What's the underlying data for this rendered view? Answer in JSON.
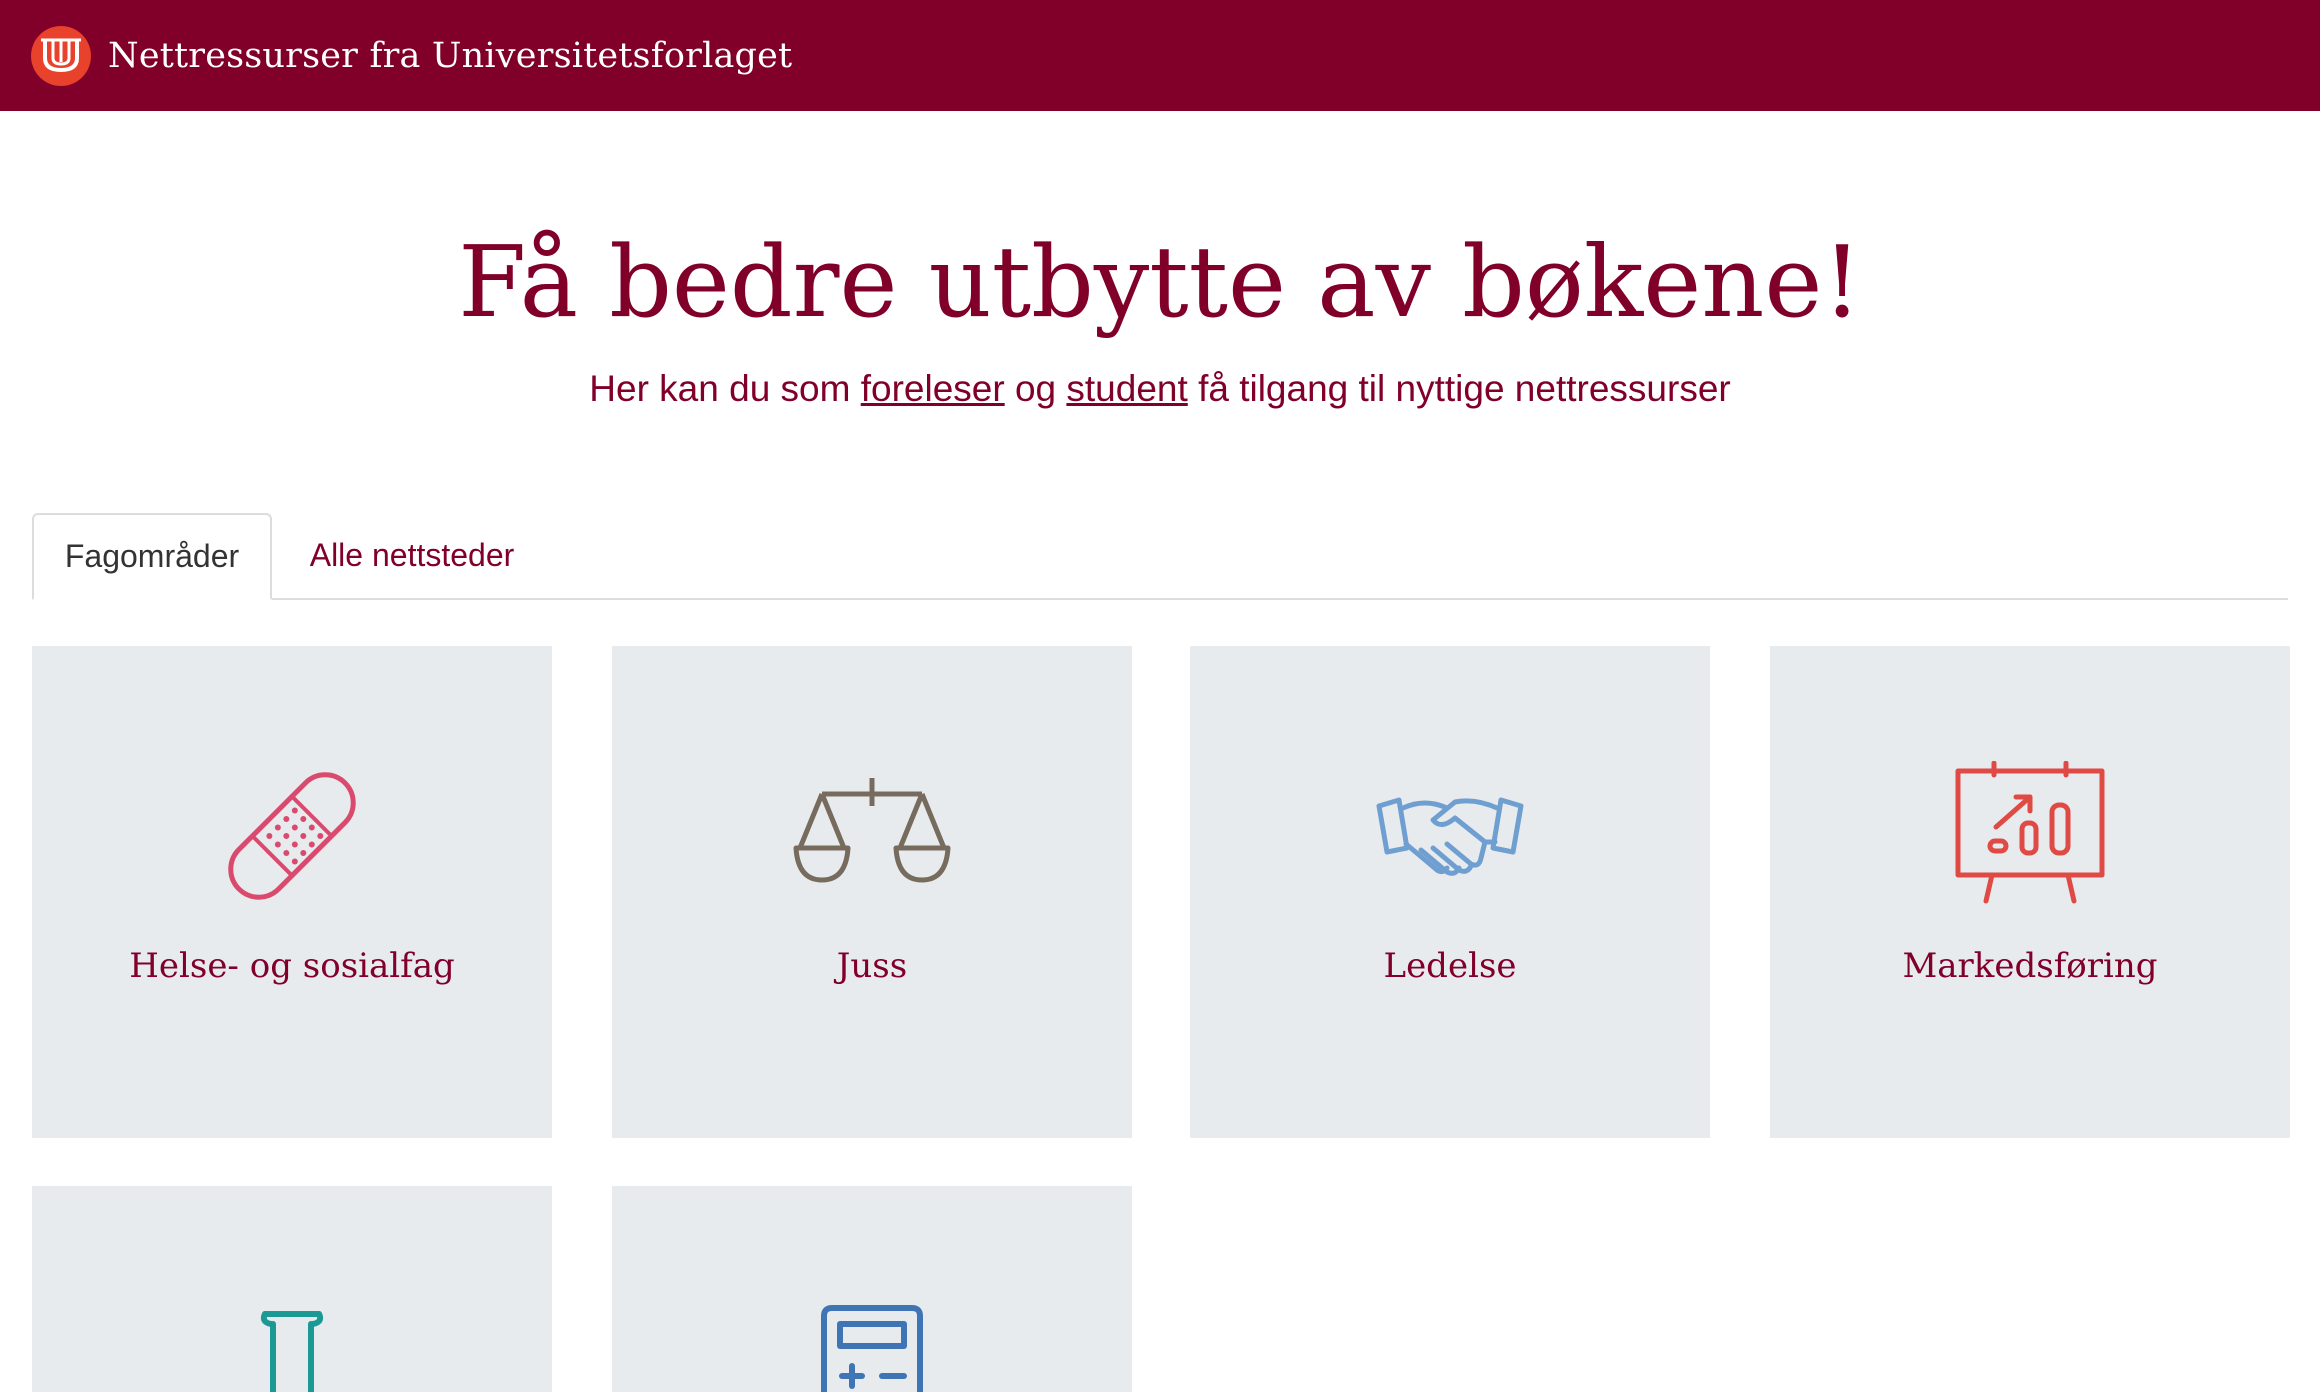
{
  "header": {
    "title": "Nettressurser fra Universitetsforlaget",
    "brand_color": "#80002a",
    "logo_color": "#e8412c"
  },
  "hero": {
    "title": "Få bedre utbytte av bøkene!",
    "subtitle_pre": "Her kan du som",
    "link_lecturer": "foreleser",
    "subtitle_mid": "og",
    "link_student": "student",
    "subtitle_post": "få tilgang til nyttige nettressurser"
  },
  "tabs": [
    {
      "label": "Fagområder",
      "active": true
    },
    {
      "label": "Alle nettsteder",
      "active": false
    }
  ],
  "cards": [
    {
      "label": "Helse- og sosialfag",
      "icon": "bandage-icon",
      "icon_color": "#d94a6e"
    },
    {
      "label": "Juss",
      "icon": "scales-icon",
      "icon_color": "#776b5d"
    },
    {
      "label": "Ledelse",
      "icon": "handshake-icon",
      "icon_color": "#6f9fd1"
    },
    {
      "label": "Markedsføring",
      "icon": "presentation-chart-icon",
      "icon_color": "#e04a45"
    },
    {
      "label": "",
      "icon": "test-tube-icon",
      "icon_color": "#1b9a95"
    },
    {
      "label": "",
      "icon": "calculator-icon",
      "icon_color": "#3f74b5"
    }
  ]
}
